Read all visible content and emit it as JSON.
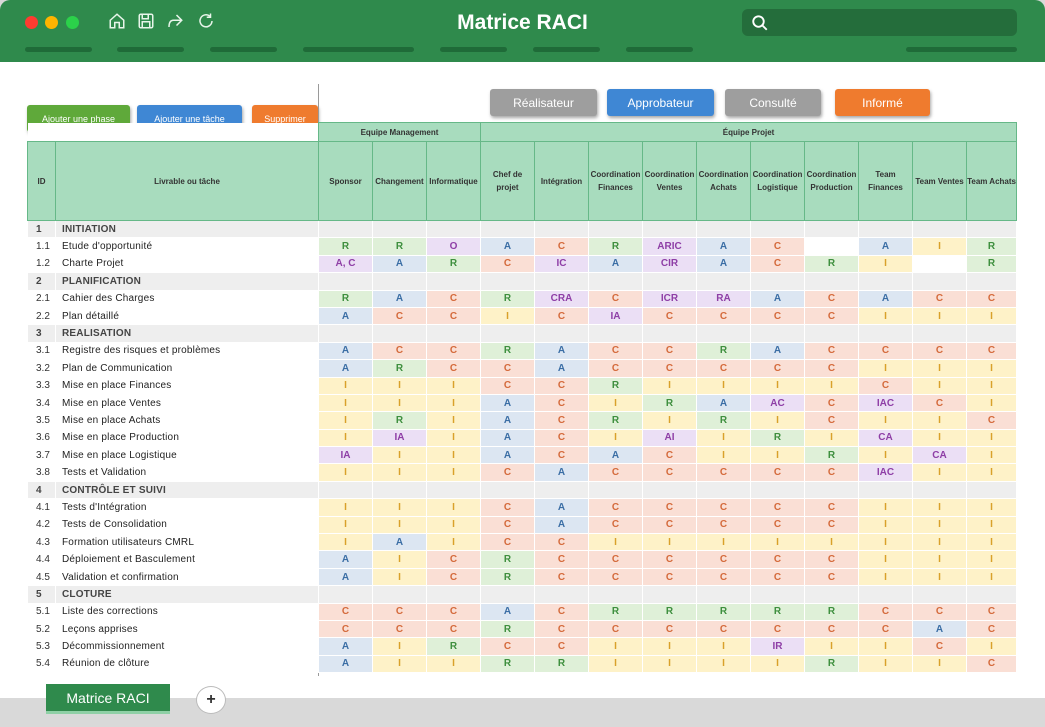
{
  "window": {
    "title": "Matrice RACI"
  },
  "toolbar": {
    "icons": [
      "home-icon",
      "save-icon",
      "share-icon",
      "refresh-icon"
    ]
  },
  "search": {
    "placeholder": ""
  },
  "actions": {
    "add_phase": "Ajouter une phase",
    "add_task": "Ajouter une tâche",
    "delete": "Supprimer"
  },
  "legend": {
    "realisateur": "Réalisateur",
    "approbateur": "Approbateur",
    "consulte": "Consulté",
    "informe": "Informé"
  },
  "groups": {
    "management": "Equipe Management",
    "projet": "Équipe Projet"
  },
  "columns": {
    "id": "ID",
    "livrable": "Livrable ou tâche",
    "roles": [
      "Sponsor",
      "Changement",
      "Informatique",
      "Chef de projet",
      "Intégration",
      "Coordination Finances",
      "Coordination Ventes",
      "Coordination Achats",
      "Coordination Logistique",
      "Coordination Production",
      "Team Finances",
      "Team Ventes",
      "Team Achats"
    ]
  },
  "colors": {
    "R": "#dff0d8",
    "A": "#dce6f2",
    "C": "#fadfd5",
    "I": "#fef2c8",
    "P": "#ebdff5",
    "E": "#ffffff",
    "R_text": "#3e8f3e",
    "A_text": "#3b6ea5",
    "C_text": "#d46a3b",
    "I_text": "#d9a12a",
    "P_text": "#8e3ea6",
    "btn_green": "#5fa93a",
    "btn_blue": "#3f87d4",
    "btn_orange": "#ef7b2e",
    "btn_grey": "#9e9e9e"
  },
  "rows": [
    {
      "type": "phase",
      "id": "1",
      "label": "INITIATION"
    },
    {
      "type": "task",
      "id": "1.1",
      "label": "Etude d'opportunité",
      "cells": [
        "R",
        "R",
        "O",
        "A",
        "C",
        "R",
        "ARIC",
        "A",
        "C",
        "",
        "A",
        "I",
        "R"
      ]
    },
    {
      "type": "task",
      "id": "1.2",
      "label": "Charte Projet",
      "cells": [
        "A, C",
        "A",
        "R",
        "C",
        "IC",
        "A",
        "CIR",
        "A",
        "C",
        "R",
        "I",
        "",
        "R"
      ]
    },
    {
      "type": "phase",
      "id": "2",
      "label": "PLANIFICATION"
    },
    {
      "type": "task",
      "id": "2.1",
      "label": "Cahier des Charges",
      "cells": [
        "R",
        "A",
        "C",
        "R",
        "CRA",
        "C",
        "ICR",
        "RA",
        "A",
        "C",
        "A",
        "C",
        "C"
      ]
    },
    {
      "type": "task",
      "id": "2.2",
      "label": "Plan détaillé",
      "cells": [
        "A",
        "C",
        "C",
        "I",
        "C",
        "IA",
        "C",
        "C",
        "C",
        "C",
        "I",
        "I",
        "I"
      ]
    },
    {
      "type": "phase",
      "id": "3",
      "label": "REALISATION"
    },
    {
      "type": "task",
      "id": "3.1",
      "label": "Registre des risques et problèmes",
      "cells": [
        "A",
        "C",
        "C",
        "R",
        "A",
        "C",
        "C",
        "R",
        "A",
        "C",
        "C",
        "C",
        "C"
      ]
    },
    {
      "type": "task",
      "id": "3.2",
      "label": "Plan de Communication",
      "cells": [
        "A",
        "R",
        "C",
        "C",
        "A",
        "C",
        "C",
        "C",
        "C",
        "C",
        "I",
        "I",
        "I"
      ]
    },
    {
      "type": "task",
      "id": "3.3",
      "label": "Mise en place Finances",
      "cells": [
        "I",
        "I",
        "I",
        "C",
        "C",
        "R",
        "I",
        "I",
        "I",
        "I",
        "C",
        "I",
        "I"
      ]
    },
    {
      "type": "task",
      "id": "3.4",
      "label": "Mise en place Ventes",
      "cells": [
        "I",
        "I",
        "I",
        "A",
        "C",
        "I",
        "R",
        "A",
        "AC",
        "C",
        "IAC",
        "C",
        "I"
      ]
    },
    {
      "type": "task",
      "id": "3.5",
      "label": "Mise en place Achats",
      "cells": [
        "I",
        "R",
        "I",
        "A",
        "C",
        "R",
        "I",
        "R",
        "I",
        "C",
        "I",
        "I",
        "C"
      ]
    },
    {
      "type": "task",
      "id": "3.6",
      "label": "Mise en place Production",
      "cells": [
        "I",
        "IA",
        "I",
        "A",
        "C",
        "I",
        "AI",
        "I",
        "R",
        "I",
        "CA",
        "I",
        "I"
      ]
    },
    {
      "type": "task",
      "id": "3.7",
      "label": "Mise en place Logistique",
      "cells": [
        "IA",
        "I",
        "I",
        "A",
        "C",
        "A",
        "C",
        "I",
        "I",
        "R",
        "I",
        "CA",
        "I"
      ]
    },
    {
      "type": "task",
      "id": "3.8",
      "label": "Tests et Validation",
      "cells": [
        "I",
        "I",
        "I",
        "C",
        "A",
        "C",
        "C",
        "C",
        "C",
        "C",
        "IAC",
        "I",
        "I"
      ]
    },
    {
      "type": "phase",
      "id": "4",
      "label": "CONTRÔLE ET SUIVI"
    },
    {
      "type": "task",
      "id": "4.1",
      "label": "Tests d'Intégration",
      "cells": [
        "I",
        "I",
        "I",
        "C",
        "A",
        "C",
        "C",
        "C",
        "C",
        "C",
        "I",
        "I",
        "I"
      ]
    },
    {
      "type": "task",
      "id": "4.2",
      "label": "Tests de Consolidation",
      "cells": [
        "I",
        "I",
        "I",
        "C",
        "A",
        "C",
        "C",
        "C",
        "C",
        "C",
        "I",
        "I",
        "I"
      ]
    },
    {
      "type": "task",
      "id": "4.3",
      "label": "Formation utilisateurs CMRL",
      "cells": [
        "I",
        "A",
        "I",
        "C",
        "C",
        "I",
        "I",
        "I",
        "I",
        "I",
        "I",
        "I",
        "I"
      ]
    },
    {
      "type": "task",
      "id": "4.4",
      "label": "Déploiement et Basculement",
      "cells": [
        "A",
        "I",
        "C",
        "R",
        "C",
        "C",
        "C",
        "C",
        "C",
        "C",
        "I",
        "I",
        "I"
      ]
    },
    {
      "type": "task",
      "id": "4.5",
      "label": "Validation et confirmation",
      "cells": [
        "A",
        "I",
        "C",
        "R",
        "C",
        "C",
        "C",
        "C",
        "C",
        "C",
        "I",
        "I",
        "I"
      ]
    },
    {
      "type": "phase",
      "id": "5",
      "label": "CLOTURE"
    },
    {
      "type": "task",
      "id": "5.1",
      "label": "Liste des corrections",
      "cells": [
        "C",
        "C",
        "C",
        "A",
        "C",
        "R",
        "R",
        "R",
        "R",
        "R",
        "C",
        "C",
        "C"
      ]
    },
    {
      "type": "task",
      "id": "5.2",
      "label": "Leçons apprises",
      "cells": [
        "C",
        "C",
        "C",
        "R",
        "C",
        "C",
        "C",
        "C",
        "C",
        "C",
        "C",
        "A",
        "C"
      ]
    },
    {
      "type": "task",
      "id": "5.3",
      "label": "Décommissionnement",
      "cells": [
        "A",
        "I",
        "R",
        "C",
        "C",
        "I",
        "I",
        "I",
        "IR",
        "I",
        "I",
        "C",
        "I"
      ]
    },
    {
      "type": "task",
      "id": "5.4",
      "label": "Réunion de clôture",
      "cells": [
        "A",
        "I",
        "I",
        "R",
        "R",
        "I",
        "I",
        "I",
        "I",
        "R",
        "I",
        "I",
        "C"
      ]
    }
  ],
  "tabs": {
    "active": "Matrice RACI",
    "add": "+"
  }
}
